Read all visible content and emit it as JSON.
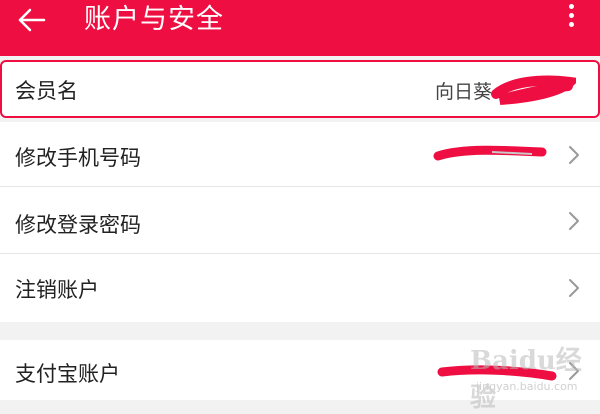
{
  "header": {
    "title": "账户与安全",
    "background": "#ee0e41",
    "back_icon": "arrow-left-icon",
    "more_icon": "more-vertical-icon"
  },
  "rows": [
    {
      "label": "会员名",
      "value": "向日葵",
      "redacted": true
    },
    {
      "label": "修改手机号码",
      "value_redacted": true
    },
    {
      "label": "修改登录密码"
    },
    {
      "label": "注销账户"
    },
    {
      "label": "支付宝账户",
      "value_redacted": true
    }
  ],
  "watermark": {
    "main": "Baidu经验",
    "sub": "jingyan.baidu.com"
  }
}
